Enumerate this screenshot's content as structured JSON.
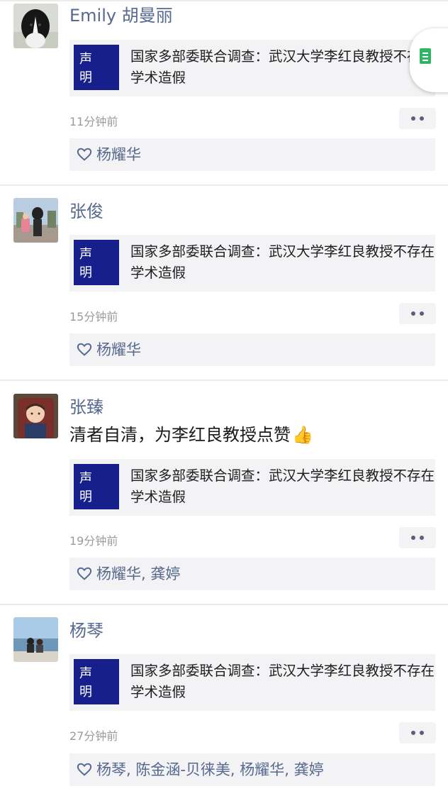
{
  "card_logo_text": "声 明",
  "colors": {
    "name": "#56698f",
    "card_logo_bg": "#161f8b",
    "card_bg": "#f3f3f5"
  },
  "posts": [
    {
      "name": "Emily 胡曼丽",
      "text": "",
      "card_title": "国家多部委联合调查：武汉大学李红良教授不存在学术造假",
      "time": "11分钟前",
      "likes": "杨耀华"
    },
    {
      "name": "张俊",
      "text": "",
      "card_title": "国家多部委联合调查：武汉大学李红良教授不存在学术造假",
      "time": "15分钟前",
      "likes": "杨耀华"
    },
    {
      "name": "张臻",
      "text": "清者自清，为李红良教授点赞",
      "card_title": "国家多部委联合调查：武汉大学李红良教授不存在学术造假",
      "time": "19分钟前",
      "likes": "杨耀华, 龚婷"
    },
    {
      "name": "杨琴",
      "text": "",
      "card_title": "国家多部委联合调查：武汉大学李红良教授不存在学术造假",
      "time": "27分钟前",
      "likes": "杨琴, 陈金涵-贝徕美, 杨耀华, 龚婷"
    }
  ],
  "icons": {
    "like": "heart-outline-icon",
    "more": "more-dots-icon",
    "float": "document-icon",
    "emoji": "thumbs-up-icon"
  }
}
